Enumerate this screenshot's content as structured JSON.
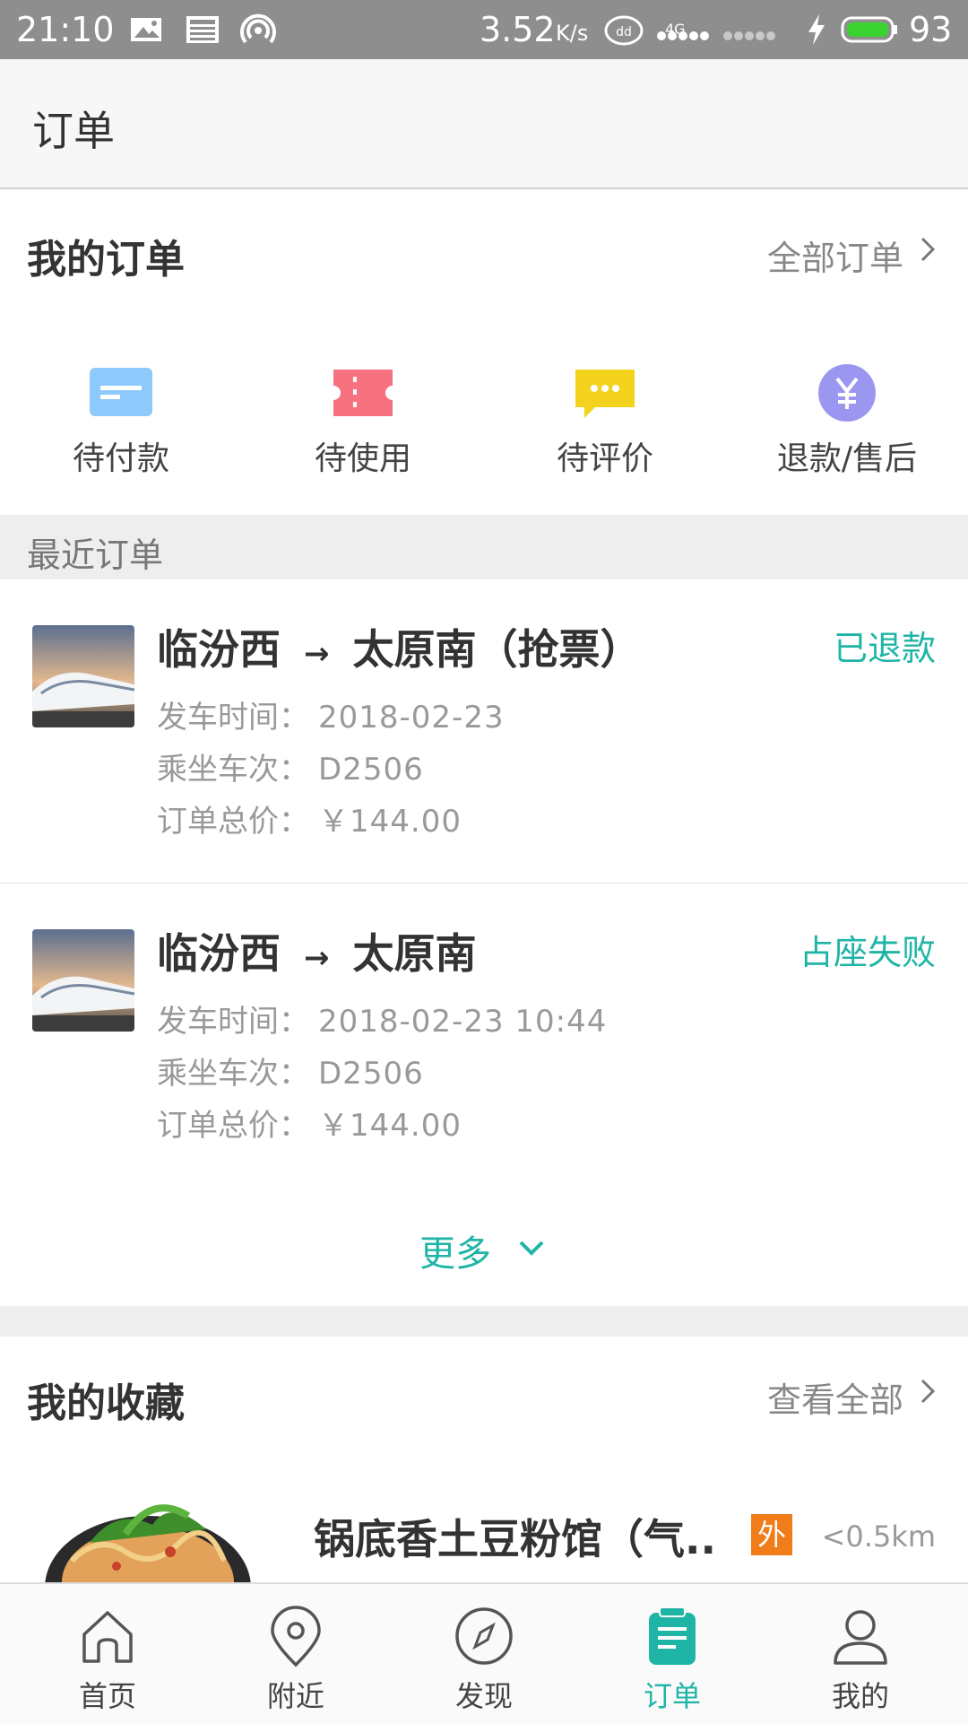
{
  "status_bar": {
    "time": "21:10",
    "net_speed": "3.52",
    "net_unit": "K/s",
    "signal_4g": "4G",
    "battery": "93",
    "icons": [
      "image-icon",
      "news-icon",
      "hotspot-icon",
      "data-badge-icon",
      "signal-icon",
      "charging-icon",
      "battery-icon"
    ]
  },
  "header": {
    "title": "订单"
  },
  "my_orders": {
    "title": "我的订单",
    "link_label": "全部订单"
  },
  "order_categories": [
    {
      "label": "待付款",
      "icon": "card-icon",
      "color": "#8ec9fb"
    },
    {
      "label": "待使用",
      "icon": "ticket-icon",
      "color": "#f5727e"
    },
    {
      "label": "待评价",
      "icon": "chat-icon",
      "color": "#f4d31f"
    },
    {
      "label": "退款/售后",
      "icon": "yen-icon",
      "color": "#9b97f0"
    }
  ],
  "recent": {
    "title": "最近订单"
  },
  "orders": [
    {
      "from": "临汾西",
      "arrow": "→",
      "to": "太原南（抢票）",
      "status": "已退款",
      "depart_label": "发车时间：",
      "depart_value": "2018-02-23",
      "train_label": "乘坐车次：",
      "train_value": "D2506",
      "price_label": "订单总价：",
      "price_value": "￥144.00"
    },
    {
      "from": "临汾西",
      "arrow": "→",
      "to": "太原南",
      "status": "占座失败",
      "depart_label": "发车时间：",
      "depart_value": "2018-02-23 10:44",
      "train_label": "乘坐车次：",
      "train_value": "D2506",
      "price_label": "订单总价：",
      "price_value": "￥144.00"
    }
  ],
  "more": {
    "label": "更多"
  },
  "favorites": {
    "title": "我的收藏",
    "link_label": "查看全部",
    "items": [
      {
        "name": "锅底香土豆粉馆（气..",
        "badge": "外",
        "distance": "<0.5km"
      }
    ]
  },
  "tabs": [
    {
      "label": "首页",
      "icon": "home-icon"
    },
    {
      "label": "附近",
      "icon": "location-icon"
    },
    {
      "label": "发现",
      "icon": "compass-icon"
    },
    {
      "label": "订单",
      "icon": "order-icon",
      "active": true
    },
    {
      "label": "我的",
      "icon": "user-icon"
    }
  ],
  "colors": {
    "accent": "#1fb5a6",
    "status_bar": "#8e8e8e",
    "badge": "#f07d1a"
  }
}
